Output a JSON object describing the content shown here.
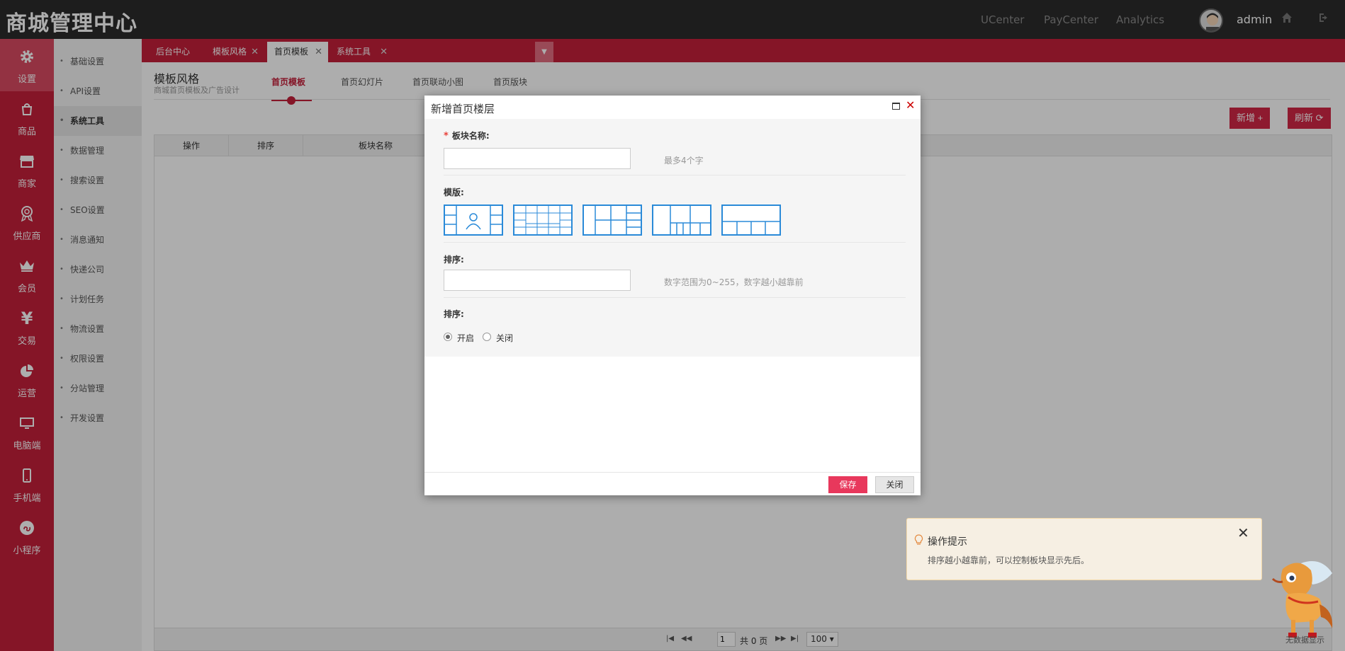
{
  "header": {
    "brand": "商城管理中心",
    "links": [
      "UCenter",
      "PayCenter",
      "Analytics"
    ],
    "username": "admin"
  },
  "leftnav": {
    "items": [
      {
        "label": "设置",
        "icon": "gear-icon"
      },
      {
        "label": "商品",
        "icon": "shopping-bag-icon"
      },
      {
        "label": "商家",
        "icon": "store-icon"
      },
      {
        "label": "供应商",
        "icon": "award-icon"
      },
      {
        "label": "会员",
        "icon": "crown-icon"
      },
      {
        "label": "交易",
        "icon": "yen-icon"
      },
      {
        "label": "运营",
        "icon": "pie-chart-icon"
      },
      {
        "label": "电脑端",
        "icon": "monitor-icon"
      },
      {
        "label": "手机端",
        "icon": "mobile-icon"
      },
      {
        "label": "小程序",
        "icon": "mini-program-icon"
      }
    ]
  },
  "subnav": {
    "items": [
      "基础设置",
      "API设置",
      "系统工具",
      "数据管理",
      "搜索设置",
      "SEO设置",
      "消息通知",
      "快递公司",
      "计划任务",
      "物流设置",
      "权限设置",
      "分站管理",
      "开发设置"
    ]
  },
  "tabs": [
    "后台中心",
    "模板风格",
    "首页模板",
    "系统工具"
  ],
  "content": {
    "title": "模板风格",
    "subtitle": "商城首页模板及广告设计",
    "subtabs": [
      "首页模板",
      "首页幻灯片",
      "首页联动小图",
      "首页版块"
    ],
    "add_button": "新增",
    "refresh_button": "刷新",
    "grid_columns": [
      "操作",
      "排序",
      "板块名称"
    ],
    "pager": {
      "page": "1",
      "total": "共 0 页",
      "page_size": "100"
    }
  },
  "modal": {
    "title": "新增首页楼层",
    "name_label": "板块名称:",
    "name_hint": "最多4个字",
    "template_label": "模版:",
    "sort_label": "排序:",
    "sort_hint": "数字范围为0~255，数字越小越靠前",
    "status_label": "排序:",
    "status_options": [
      "开启",
      "关闭"
    ],
    "save_button": "保存",
    "close_button": "关闭"
  },
  "tip": {
    "title": "操作提示",
    "text": "排序越小越靠前，可以控制板块显示先后。"
  },
  "mascot_label": "无数据显示",
  "colors": {
    "brand_red": "#c41f3a",
    "topbar": "#2b2b2b",
    "template_blue": "#2a8ad8"
  }
}
